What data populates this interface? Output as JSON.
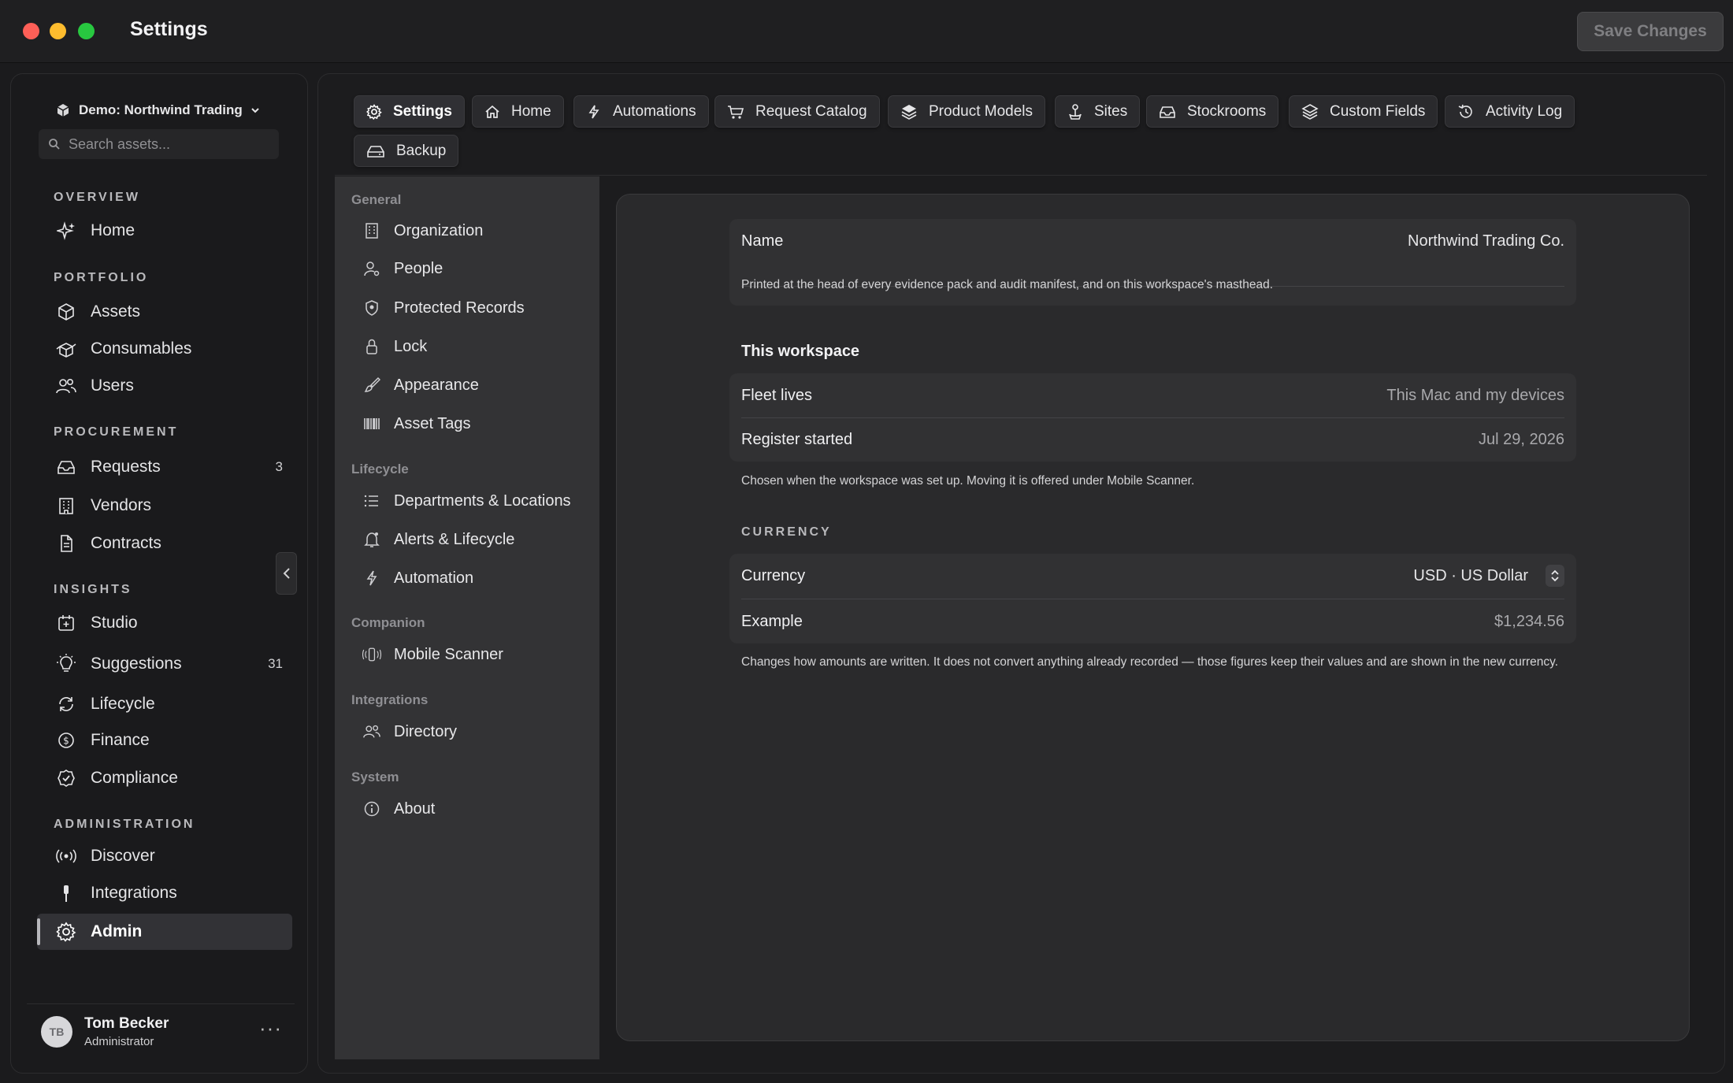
{
  "window": {
    "title": "Settings",
    "save_label": "Save Changes"
  },
  "sidebar": {
    "workspace": "Demo: Northwind Trading",
    "search_placeholder": "Search assets...",
    "sections": {
      "overview": "OVERVIEW",
      "portfolio": "PORTFOLIO",
      "procurement": "PROCUREMENT",
      "insights": "INSIGHTS",
      "administration": "ADMINISTRATION"
    },
    "items": {
      "home": "Home",
      "assets": "Assets",
      "consumables": "Consumables",
      "users": "Users",
      "requests": "Requests",
      "requests_badge": "3",
      "vendors": "Vendors",
      "contracts": "Contracts",
      "studio": "Studio",
      "suggestions": "Suggestions",
      "suggestions_badge": "31",
      "lifecycle": "Lifecycle",
      "finance": "Finance",
      "compliance": "Compliance",
      "discover": "Discover",
      "integrations": "Integrations",
      "admin": "Admin"
    },
    "user": {
      "initials": "TB",
      "name": "Tom Becker",
      "role": "Administrator"
    }
  },
  "tabs": {
    "settings": "Settings",
    "home": "Home",
    "automations": "Automations",
    "request_catalog": "Request Catalog",
    "product_models": "Product Models",
    "sites": "Sites",
    "stockrooms": "Stockrooms",
    "custom_fields": "Custom Fields",
    "activity_log": "Activity Log",
    "backup": "Backup"
  },
  "subnav": {
    "general": "General",
    "organization": "Organization",
    "people": "People",
    "protected_records": "Protected Records",
    "lock": "Lock",
    "appearance": "Appearance",
    "asset_tags": "Asset Tags",
    "lifecycle": "Lifecycle",
    "departments": "Departments & Locations",
    "alerts": "Alerts & Lifecycle",
    "automation": "Automation",
    "companion": "Companion",
    "mobile_scanner": "Mobile Scanner",
    "integrations": "Integrations",
    "directory": "Directory",
    "system": "System",
    "about": "About"
  },
  "content": {
    "name_label": "Name",
    "name_value": "Northwind Trading Co.",
    "name_note": "Printed at the head of every evidence pack and audit manifest, and on this workspace's masthead.",
    "workspace_heading": "This workspace",
    "fleet_label": "Fleet lives",
    "fleet_value": "This Mac and my devices",
    "register_label": "Register started",
    "register_value": "Jul 29, 2026",
    "workspace_note": "Chosen when the workspace was set up. Moving it is offered under Mobile Scanner.",
    "currency_heading": "CURRENCY",
    "currency_label": "Currency",
    "currency_value": "USD · US Dollar",
    "example_label": "Example",
    "example_value": "$1,234.56",
    "currency_note": "Changes how amounts are written. It does not convert anything already recorded — those figures keep their values and are shown in the new currency."
  }
}
